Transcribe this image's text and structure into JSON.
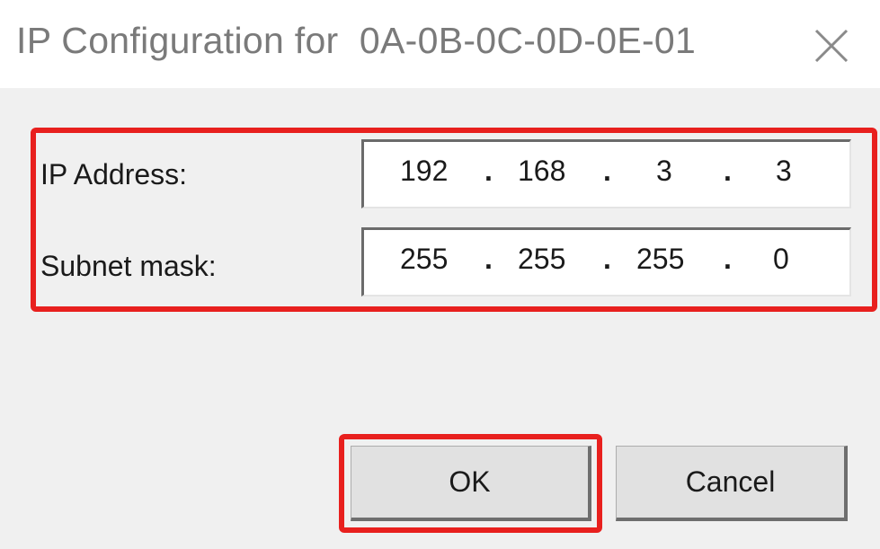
{
  "dialog": {
    "title": "IP Configuration for  0A-0B-0C-0D-0E-01",
    "close_icon": "close-icon"
  },
  "fields": {
    "ip_label": "IP Address:",
    "ip_octets": [
      "192",
      "168",
      "3",
      "3"
    ],
    "mask_label": "Subnet mask:",
    "mask_octets": [
      "255",
      "255",
      "255",
      "0"
    ],
    "separator": "."
  },
  "buttons": {
    "ok_label": "OK",
    "cancel_label": "Cancel"
  },
  "colors": {
    "highlight": "#e8201e",
    "dialog_background": "#f0f0f0",
    "title_text": "#7a7a7a"
  }
}
